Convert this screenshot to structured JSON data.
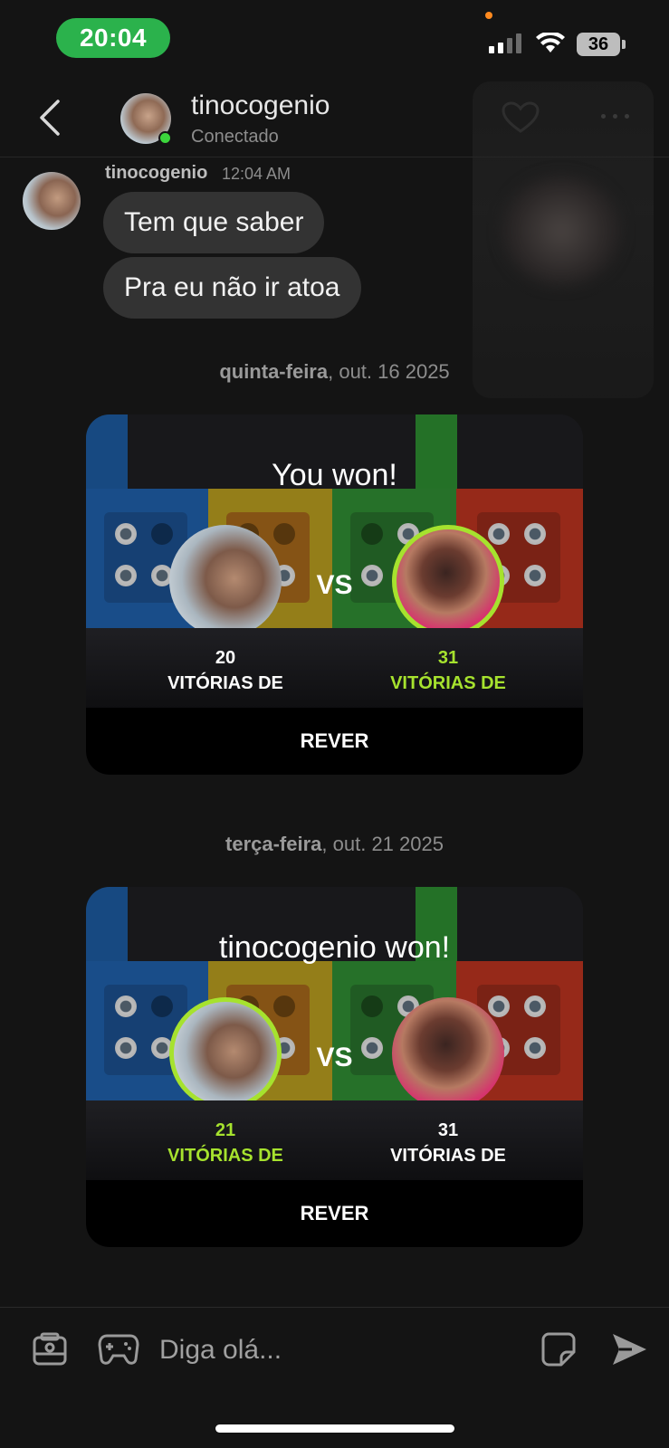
{
  "status_bar": {
    "time": "20:04",
    "battery": "36"
  },
  "header": {
    "name": "tinocogenio",
    "status": "Conectado"
  },
  "messages": {
    "sender": "tinocogenio",
    "time": "12:04 AM",
    "bubbles": [
      "Tem que saber",
      "Pra eu não ir atoa"
    ]
  },
  "games": [
    {
      "date_day": "quinta-feira",
      "date_rest": ", out. 16 2025",
      "title": "You won!",
      "vs": "VS",
      "left_wins": "20",
      "left_label": "VITÓRIAS DE",
      "right_wins": "31",
      "right_label": "VITÓRIAS DE",
      "highlight": "right",
      "action": "REVER"
    },
    {
      "date_day": "terça-feira",
      "date_rest": ", out. 21 2025",
      "title": "tinocogenio won!",
      "vs": "VS",
      "left_wins": "21",
      "left_label": "VITÓRIAS DE",
      "right_wins": "31",
      "right_label": "VITÓRIAS DE",
      "highlight": "left",
      "action": "REVER"
    }
  ],
  "composer": {
    "placeholder": "Diga olá..."
  },
  "colors": {
    "accent_green": "#a6e22e",
    "online": "#3cd63c",
    "time_pill": "#2bb24c"
  },
  "icons": [
    "back-icon",
    "heart-icon",
    "more-icon",
    "gallery-icon",
    "gamepad-icon",
    "sticker-icon",
    "send-icon"
  ]
}
